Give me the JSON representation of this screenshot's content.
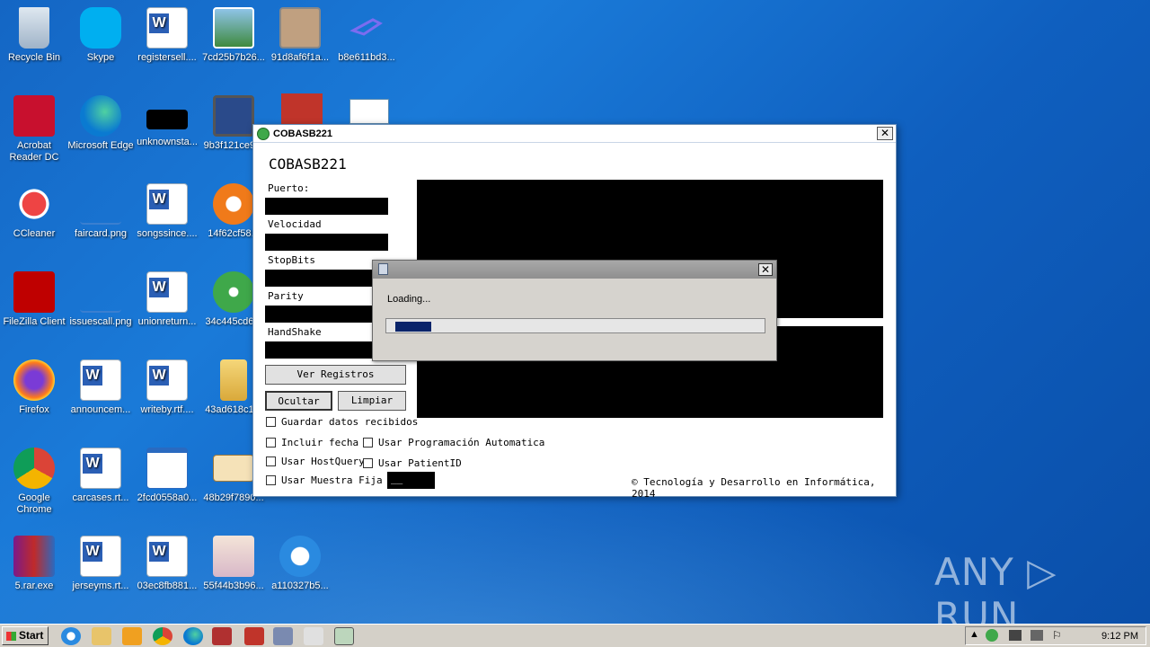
{
  "desktop": {
    "icons": [
      {
        "label": "Recycle Bin"
      },
      {
        "label": "Skype"
      },
      {
        "label": "registersell...."
      },
      {
        "label": "7cd25b7b26..."
      },
      {
        "label": "91d8af6f1a..."
      },
      {
        "label": "b8e611bd3..."
      },
      {
        "label": "Acrobat Reader DC"
      },
      {
        "label": "Microsoft Edge"
      },
      {
        "label": "unknownsta..."
      },
      {
        "label": "9b3f121ce9..."
      },
      {
        "label": "CCleaner"
      },
      {
        "label": "faircard.png"
      },
      {
        "label": "songssince...."
      },
      {
        "label": "14f62cf58..."
      },
      {
        "label": "FileZilla Client"
      },
      {
        "label": "issuescall.png"
      },
      {
        "label": "unionreturn..."
      },
      {
        "label": "34c445cd6..."
      },
      {
        "label": "Firefox"
      },
      {
        "label": "announcem..."
      },
      {
        "label": "writeby.rtf...."
      },
      {
        "label": "43ad618c1..."
      },
      {
        "label": "Google Chrome"
      },
      {
        "label": "carcases.rt..."
      },
      {
        "label": "2fcd0558a0..."
      },
      {
        "label": "48b29f7890..."
      },
      {
        "label": "5.rar.exe"
      },
      {
        "label": "jerseyms.rt..."
      },
      {
        "label": "03ec8fb881..."
      },
      {
        "label": "55f44b3b96..."
      },
      {
        "label": "a110327b5..."
      }
    ]
  },
  "app": {
    "window_title": "COBASB221",
    "heading": "COBASB221",
    "fields": {
      "puerto": "Puerto:",
      "velocidad": "Velocidad",
      "stopbits": "StopBits",
      "parity": "Parity",
      "handshake": "HandShake"
    },
    "buttons": {
      "ver_registros": "Ver Registros",
      "ocultar": "Ocultar",
      "limpiar": "Limpiar"
    },
    "checkboxes": {
      "guardar": "Guardar datos recibidos",
      "incluir_fecha": "Incluir fecha",
      "usar_programacion": "Usar Programación Automatica",
      "usar_hostquery": "Usar HostQuery",
      "usar_patientid": "Usar PatientID",
      "usar_muestra": "Usar Muestra Fija"
    },
    "muestra_value": "__",
    "copyright": "© Tecnología y Desarrollo en Informática, 2014"
  },
  "dialog": {
    "message": "Loading...",
    "progress_fraction": 0.1
  },
  "taskbar": {
    "start_label": "Start",
    "clock": "9:12 PM"
  },
  "watermark": "ANY ▷ RUN"
}
